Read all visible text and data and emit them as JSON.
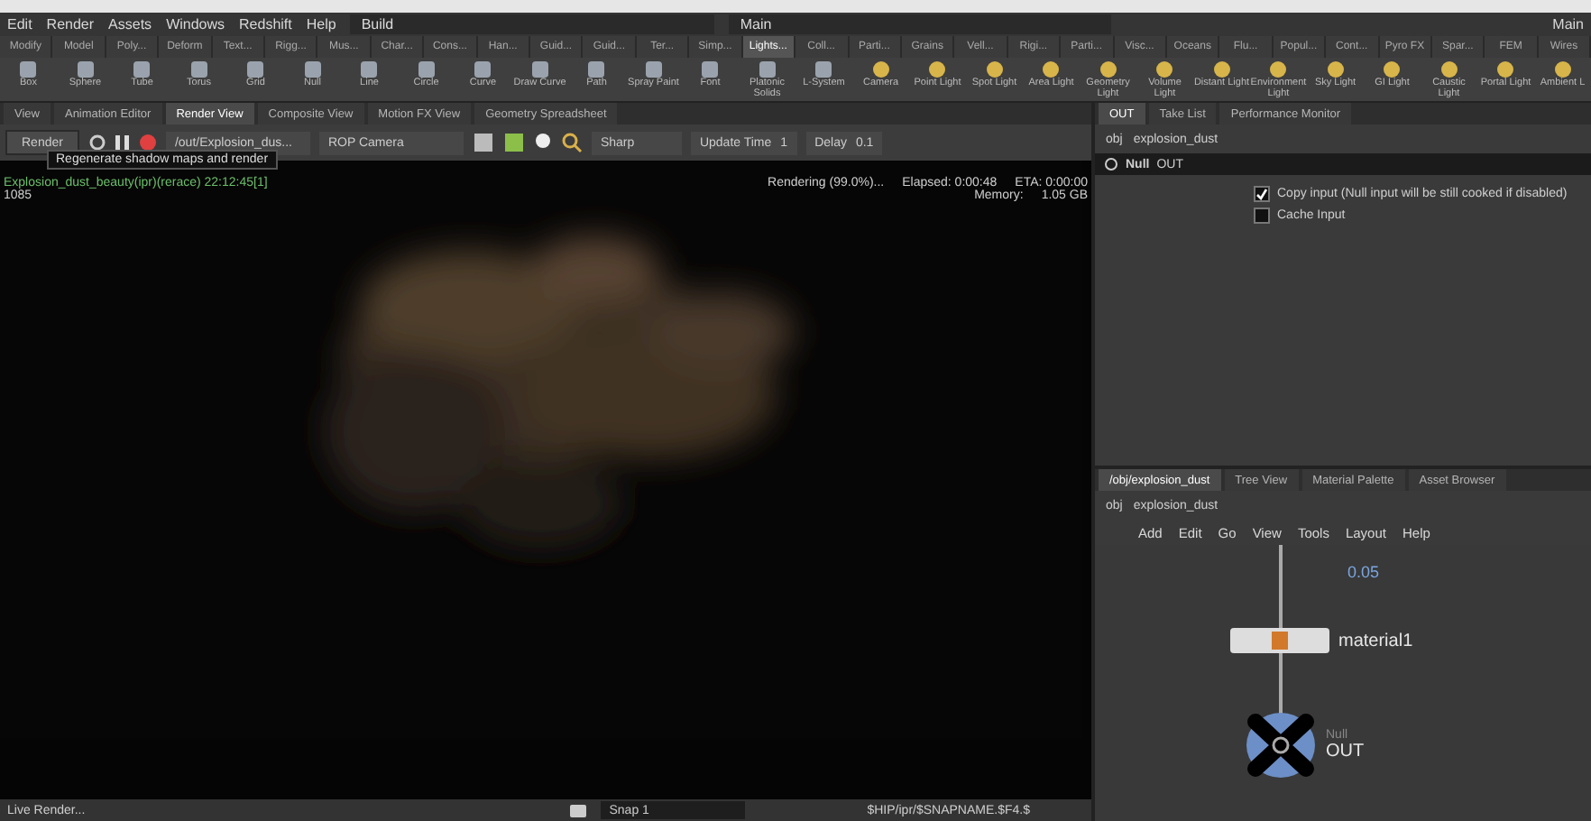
{
  "menu": [
    "Edit",
    "Render",
    "Assets",
    "Windows",
    "Redshift",
    "Help"
  ],
  "desktop": {
    "build": "Build",
    "main": "Main",
    "right_label": "Main"
  },
  "shelf_tabs": [
    {
      "label": "Modify",
      "selected": false
    },
    {
      "label": "Model",
      "selected": false
    },
    {
      "label": "Poly...",
      "selected": false
    },
    {
      "label": "Deform",
      "selected": false
    },
    {
      "label": "Text...",
      "selected": false
    },
    {
      "label": "Rigg...",
      "selected": false
    },
    {
      "label": "Mus...",
      "selected": false
    },
    {
      "label": "Char...",
      "selected": false
    },
    {
      "label": "Cons...",
      "selected": false
    },
    {
      "label": "Han...",
      "selected": false
    },
    {
      "label": "Guid...",
      "selected": false
    },
    {
      "label": "Guid...",
      "selected": false
    },
    {
      "label": "Ter...",
      "selected": false
    },
    {
      "label": "Simp...",
      "selected": false
    },
    {
      "label": "Lights...",
      "selected": true
    },
    {
      "label": "Coll...",
      "selected": false
    },
    {
      "label": "Parti...",
      "selected": false
    },
    {
      "label": "Grains",
      "selected": false
    },
    {
      "label": "Vell...",
      "selected": false
    },
    {
      "label": "Rigi...",
      "selected": false
    },
    {
      "label": "Parti...",
      "selected": false
    },
    {
      "label": "Visc...",
      "selected": false
    },
    {
      "label": "Oceans",
      "selected": false
    },
    {
      "label": "Flu...",
      "selected": false
    },
    {
      "label": "Popul...",
      "selected": false
    },
    {
      "label": "Cont...",
      "selected": false
    },
    {
      "label": "Pyro FX",
      "selected": false
    },
    {
      "label": "Spar...",
      "selected": false
    },
    {
      "label": "FEM",
      "selected": false
    },
    {
      "label": "Wires",
      "selected": false
    }
  ],
  "shelf_tools": [
    {
      "label": "Box",
      "kind": "geo"
    },
    {
      "label": "Sphere",
      "kind": "geo"
    },
    {
      "label": "Tube",
      "kind": "geo"
    },
    {
      "label": "Torus",
      "kind": "geo"
    },
    {
      "label": "Grid",
      "kind": "geo"
    },
    {
      "label": "Null",
      "kind": "geo"
    },
    {
      "label": "Line",
      "kind": "geo"
    },
    {
      "label": "Circle",
      "kind": "geo"
    },
    {
      "label": "Curve",
      "kind": "geo"
    },
    {
      "label": "Draw Curve",
      "kind": "geo"
    },
    {
      "label": "Path",
      "kind": "geo"
    },
    {
      "label": "Spray Paint",
      "kind": "geo"
    },
    {
      "label": "Font",
      "kind": "geo"
    },
    {
      "label": "Platonic Solids",
      "kind": "geo"
    },
    {
      "label": "L-System",
      "kind": "geo"
    },
    {
      "label": "Camera",
      "kind": "light"
    },
    {
      "label": "Point Light",
      "kind": "light"
    },
    {
      "label": "Spot Light",
      "kind": "light"
    },
    {
      "label": "Area Light",
      "kind": "light"
    },
    {
      "label": "Geometry Light",
      "kind": "light"
    },
    {
      "label": "Volume Light",
      "kind": "light"
    },
    {
      "label": "Distant Light",
      "kind": "light"
    },
    {
      "label": "Environment Light",
      "kind": "light"
    },
    {
      "label": "Sky Light",
      "kind": "light"
    },
    {
      "label": "GI Light",
      "kind": "light"
    },
    {
      "label": "Caustic Light",
      "kind": "light"
    },
    {
      "label": "Portal Light",
      "kind": "light"
    },
    {
      "label": "Ambient L",
      "kind": "light"
    }
  ],
  "left_tabs": [
    {
      "label": "View",
      "selected": false
    },
    {
      "label": "Animation Editor",
      "selected": false
    },
    {
      "label": "Render View",
      "selected": true
    },
    {
      "label": "Composite View",
      "selected": false
    },
    {
      "label": "Motion FX View",
      "selected": false
    },
    {
      "label": "Geometry Spreadsheet",
      "selected": false
    }
  ],
  "render_toolbar": {
    "render": "Render",
    "rop": "/out/Explosion_dus...",
    "camera": "ROP Camera",
    "sharp": "Sharp",
    "update_time_label": "Update Time",
    "update_time": "1",
    "delay_label": "Delay",
    "delay": "0.1"
  },
  "tooltip": "Regenerate shadow maps and render",
  "render_info": {
    "title": "Explosion_dust_beauty(ipr)(rerace) 22:12:45[1]",
    "frame": "1085",
    "status": "Rendering (99.0%)...",
    "elapsed": "Elapsed: 0:00:48",
    "eta": "ETA: 0:00:00",
    "memory_label": "Memory:",
    "memory": "1.05 GB"
  },
  "render_image": {
    "kind": "picture"
  },
  "bottom_bar": {
    "left": "Live Render...",
    "snap": "Snap 1",
    "path": "$HIP/ipr/$SNAPNAME.$F4.$"
  },
  "params_pane": {
    "tabs": [
      {
        "label": "OUT",
        "selected": true
      },
      {
        "label": "Take List",
        "selected": false
      },
      {
        "label": "Performance Monitor",
        "selected": false
      }
    ],
    "path": [
      "obj",
      "explosion_dust"
    ],
    "node_type": "Null",
    "node_name": "OUT",
    "options": [
      {
        "label": "Copy input (Null input will be still cooked if disabled)",
        "checked": true
      },
      {
        "label": "Cache Input",
        "checked": false
      }
    ]
  },
  "network_pane": {
    "tabs": [
      {
        "label": "/obj/explosion_dust",
        "selected": true
      },
      {
        "label": "Tree View",
        "selected": false
      },
      {
        "label": "Material Palette",
        "selected": false
      },
      {
        "label": "Asset Browser",
        "selected": false
      }
    ],
    "path": [
      "obj",
      "explosion_dust"
    ],
    "menu": [
      "Add",
      "Edit",
      "Go",
      "View",
      "Tools",
      "Layout",
      "Help"
    ],
    "value": "0.05",
    "nodes": [
      {
        "name": "material1",
        "kind": "material"
      },
      {
        "type": "Null",
        "name": "OUT",
        "kind": "null"
      }
    ]
  }
}
